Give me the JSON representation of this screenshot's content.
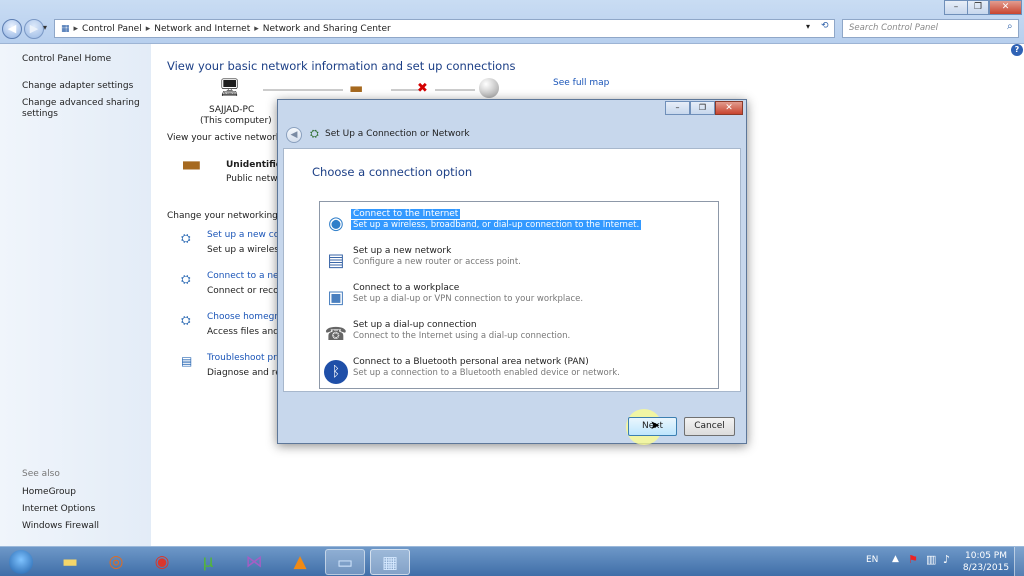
{
  "explorer": {
    "breadcrumb": [
      "Control Panel",
      "Network and Internet",
      "Network and Sharing Center"
    ],
    "search_placeholder": "Search Control Panel",
    "window_controls": [
      "–",
      "❐",
      "✕"
    ]
  },
  "left_pane": {
    "links": [
      "Control Panel Home",
      "Change adapter settings",
      "Change advanced sharing",
      "settings"
    ],
    "see_also_heading": "See also",
    "see_also": [
      "HomeGroup",
      "Internet Options",
      "Windows Firewall"
    ]
  },
  "main": {
    "title": "View your basic network information and set up connections",
    "see_full_map": "See full map",
    "computer_name": "SAJJAD-PC",
    "computer_sub": "(This computer)",
    "active_networks_label": "View your active networks",
    "network_name": "Unidentified",
    "network_type": "Public netwo",
    "change_settings_label": "Change your networking se",
    "tasks": [
      {
        "title": "Set up a new con",
        "desc": "Set up a wireless,"
      },
      {
        "title": "Connect to a netw",
        "desc": "Connect or recon"
      },
      {
        "title": "Choose homegro",
        "desc": "Access files and p"
      },
      {
        "title": "Troubleshoot pro",
        "desc": "Diagnose and rep"
      }
    ]
  },
  "dialog": {
    "title": "Set Up a Connection or Network",
    "heading": "Choose a connection option",
    "options": [
      {
        "title": "Connect to the Internet",
        "desc": "Set up a wireless, broadband, or dial-up connection to the Internet.",
        "icon": "globe-icon",
        "selected": true
      },
      {
        "title": "Set up a new network",
        "desc": "Configure a new router or access point.",
        "icon": "router-icon",
        "selected": false
      },
      {
        "title": "Connect to a workplace",
        "desc": "Set up a dial-up or VPN connection to your workplace.",
        "icon": "workplace-icon",
        "selected": false
      },
      {
        "title": "Set up a dial-up connection",
        "desc": "Connect to the Internet using a dial-up connection.",
        "icon": "phone-icon",
        "selected": false
      },
      {
        "title": "Connect to a Bluetooth personal area network (PAN)",
        "desc": "Set up a connection to a Bluetooth enabled device or network.",
        "icon": "bluetooth-icon",
        "selected": false
      }
    ],
    "next_label": "Next",
    "cancel_label": "Cancel"
  },
  "taskbar": {
    "language": "EN",
    "time": "10:05 PM",
    "date": "8/23/2015"
  },
  "colors": {
    "selection": "#3399ff",
    "link": "#1a55b8",
    "taskbar": "#3f6ea8"
  }
}
